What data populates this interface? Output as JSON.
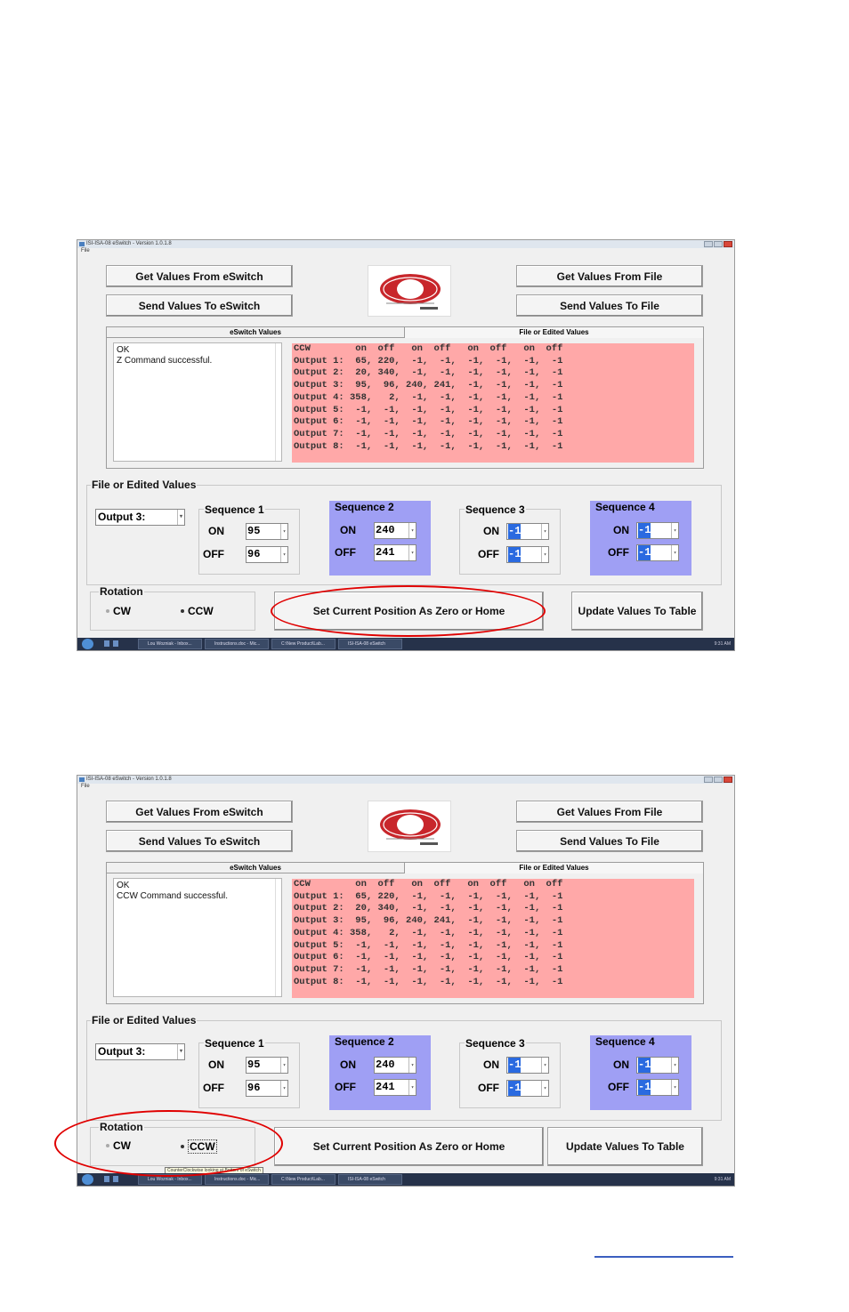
{
  "screens": [
    {
      "window_title": "ISI-ISA-08 eSwitch - Version 1.0.1.8",
      "menu": "File",
      "buttons": {
        "get_from_eswitch": "Get Values From eSwitch",
        "send_to_eswitch": "Send Values To eSwitch",
        "get_from_file": "Get Values From File",
        "send_to_file": "Send Values To File",
        "set_zero": "Set Current Position As Zero or Home",
        "update_table": "Update Values To Table"
      },
      "tabs": [
        "eSwitch Values",
        "File or Edited Values"
      ],
      "status_lines": [
        "OK",
        "Z Command successful."
      ],
      "table_rows": [
        "CCW        on  off   on  off   on  off   on  off",
        "Output 1:  65, 220,  -1,  -1,  -1,  -1,  -1,  -1",
        "Output 2:  20, 340,  -1,  -1,  -1,  -1,  -1,  -1",
        "Output 3:  95,  96, 240, 241,  -1,  -1,  -1,  -1",
        "Output 4: 358,   2,  -1,  -1,  -1,  -1,  -1,  -1",
        "Output 5:  -1,  -1,  -1,  -1,  -1,  -1,  -1,  -1",
        "Output 6:  -1,  -1,  -1,  -1,  -1,  -1,  -1,  -1",
        "Output 7:  -1,  -1,  -1,  -1,  -1,  -1,  -1,  -1",
        "Output 8:  -1,  -1,  -1,  -1,  -1,  -1,  -1,  -1"
      ],
      "edit_group_title": "File or Edited Values",
      "output_select": "Output 3:",
      "on_label": "ON",
      "off_label": "OFF",
      "sequences": [
        {
          "title": "Sequence 1",
          "on": "95",
          "off": "96",
          "highlight": false
        },
        {
          "title": "Sequence 2",
          "on": "240",
          "off": "241",
          "highlight": true
        },
        {
          "title": "Sequence 3",
          "on": "-1",
          "off": "-1",
          "highlight": false
        },
        {
          "title": "Sequence 4",
          "on": "-1",
          "off": "-1",
          "highlight": true
        }
      ],
      "rotation": {
        "title": "Rotation",
        "cw": "CW",
        "ccw": "CCW",
        "selected": "CCW"
      },
      "taskbar_items": [
        "Lou Wozniak - Inbox...",
        "Instructions.doc - Mic...",
        "C:\\New Product\\Lab...",
        "ISI-ISA-08 eSwitch"
      ],
      "tray_text": "9:31 AM",
      "annotation_target": "set_zero"
    },
    {
      "window_title": "ISI-ISA-08 eSwitch - Version 1.0.1.8",
      "menu": "File",
      "buttons": {
        "get_from_eswitch": "Get Values From eSwitch",
        "send_to_eswitch": "Send Values To eSwitch",
        "get_from_file": "Get Values From File",
        "send_to_file": "Send Values To File",
        "set_zero": "Set Current Position As Zero or Home",
        "update_table": "Update Values To Table"
      },
      "tabs": [
        "eSwitch Values",
        "File or Edited Values"
      ],
      "status_lines": [
        "OK",
        "CCW Command successful."
      ],
      "table_rows": [
        "CCW        on  off   on  off   on  off   on  off",
        "Output 1:  65, 220,  -1,  -1,  -1,  -1,  -1,  -1",
        "Output 2:  20, 340,  -1,  -1,  -1,  -1,  -1,  -1",
        "Output 3:  95,  96, 240, 241,  -1,  -1,  -1,  -1",
        "Output 4: 358,   2,  -1,  -1,  -1,  -1,  -1,  -1",
        "Output 5:  -1,  -1,  -1,  -1,  -1,  -1,  -1,  -1",
        "Output 6:  -1,  -1,  -1,  -1,  -1,  -1,  -1,  -1",
        "Output 7:  -1,  -1,  -1,  -1,  -1,  -1,  -1,  -1",
        "Output 8:  -1,  -1,  -1,  -1,  -1,  -1,  -1,  -1"
      ],
      "edit_group_title": "File or Edited Values",
      "output_select": "Output 3:",
      "on_label": "ON",
      "off_label": "OFF",
      "sequences": [
        {
          "title": "Sequence 1",
          "on": "95",
          "off": "96",
          "highlight": false
        },
        {
          "title": "Sequence 2",
          "on": "240",
          "off": "241",
          "highlight": true
        },
        {
          "title": "Sequence 3",
          "on": "-1",
          "off": "-1",
          "highlight": false
        },
        {
          "title": "Sequence 4",
          "on": "-1",
          "off": "-1",
          "highlight": true
        }
      ],
      "rotation": {
        "title": "Rotation",
        "cw": "CW",
        "ccw": "CCW",
        "selected": "CCW"
      },
      "tooltip": "CounterClockwise looking at Bottom of eSwitch",
      "taskbar_items": [
        "Lou Wozniak - Inbox...",
        "Instructions.doc - Mic...",
        "C:\\New Product\\Lab...",
        "ISI-ISA-08 eSwitch"
      ],
      "tray_text": "9:31 AM",
      "annotation_target": "rotation"
    }
  ],
  "colors": {
    "table_bg": "#ffa8a8",
    "sequence_highlight": "#9f9ff4",
    "selection_blue": "#2a6ae0",
    "annotation_red": "#e00000",
    "window_bg": "#f0f0f0"
  }
}
